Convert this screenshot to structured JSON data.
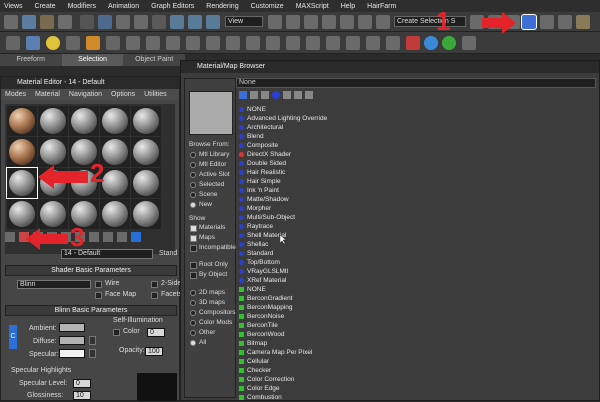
{
  "menu": [
    "Views",
    "Create",
    "Modifiers",
    "Animation",
    "Graph Editors",
    "Rendering",
    "Customize",
    "MAXScript",
    "Help",
    "HairFarm"
  ],
  "toolbar": {
    "view_select": "View",
    "selection_set": "Create Selection S"
  },
  "ribbon": {
    "tabs": [
      "Freeform",
      "Selection",
      "Object Paint"
    ],
    "active": "Selection"
  },
  "material_editor": {
    "title": "Material Editor - 14 - Default",
    "menu": [
      "Modes",
      "Material",
      "Navigation",
      "Options",
      "Utilities"
    ],
    "material_name": "14 - Default",
    "standard_label": "Stand",
    "shader_section": "Shader Basic Parameters",
    "shader_value": "Blinn",
    "shader_options": [
      "Wire",
      "2-Side",
      "Face Map",
      "Facets"
    ],
    "blinn_section": "Blinn Basic Parameters",
    "self_illum_label": "Self-Illumination",
    "color_label": "Color",
    "color_value": "0",
    "ambient_label": "Ambient:",
    "diffuse_label": "Diffuse:",
    "specular_label": "Specular:",
    "opacity_label": "Opacity:",
    "opacity_value": "100",
    "spec_highlights_label": "Specular Highlights",
    "spec_level_label": "Specular Level:",
    "spec_level_value": "0",
    "glossiness_label": "Glossiness:",
    "glossiness_value": "10",
    "lock_label": "C"
  },
  "browser": {
    "title": "Material/Map Browser",
    "search_value": "None",
    "browse_from_label": "Browse From:",
    "browse_from": [
      "Mtl Library",
      "Mtl Editor",
      "Active Slot",
      "Selected",
      "Scene",
      "New"
    ],
    "browse_selected": "New",
    "show_label": "Show",
    "show": [
      "Materials",
      "Maps",
      "Incompatible"
    ],
    "show_checked": [
      "Materials",
      "Maps"
    ],
    "root_only": "Root Only",
    "by_object": "By Object",
    "map_types": [
      "2D maps",
      "3D maps",
      "Compositors",
      "Color Mods",
      "Other",
      "All"
    ],
    "map_selected": "All",
    "materials": [
      "NONE",
      "Advanced Lighting Override",
      "Architectural",
      "Blend",
      "Composite",
      "DirectX Shader",
      "Double Sided",
      "Hair Realistic",
      "Hair Simple",
      "Ink 'n Paint",
      "Matte/Shadow",
      "Morpher",
      "Multi/Sub-Object",
      "Raytrace",
      "Shell Material",
      "Shellac",
      "Standard",
      "Top/Bottom",
      "VRayGLSLMtl",
      "XRef Material"
    ],
    "maps": [
      "NONE",
      "BerconGradient",
      "BerconMapping",
      "BerconNoise",
      "BerconTile",
      "BerconWood",
      "Bitmap",
      "Camera Map Per Pixel",
      "Cellular",
      "Checker",
      "Color Correction",
      "Color Edge",
      "Combustion"
    ]
  },
  "callouts": [
    "1",
    "2",
    "3"
  ],
  "colors": {
    "arrow": "#e4232a",
    "material_dot": "#2a3fd8",
    "map_square": "#2ec42e",
    "directx_dot": "#e2332f"
  }
}
